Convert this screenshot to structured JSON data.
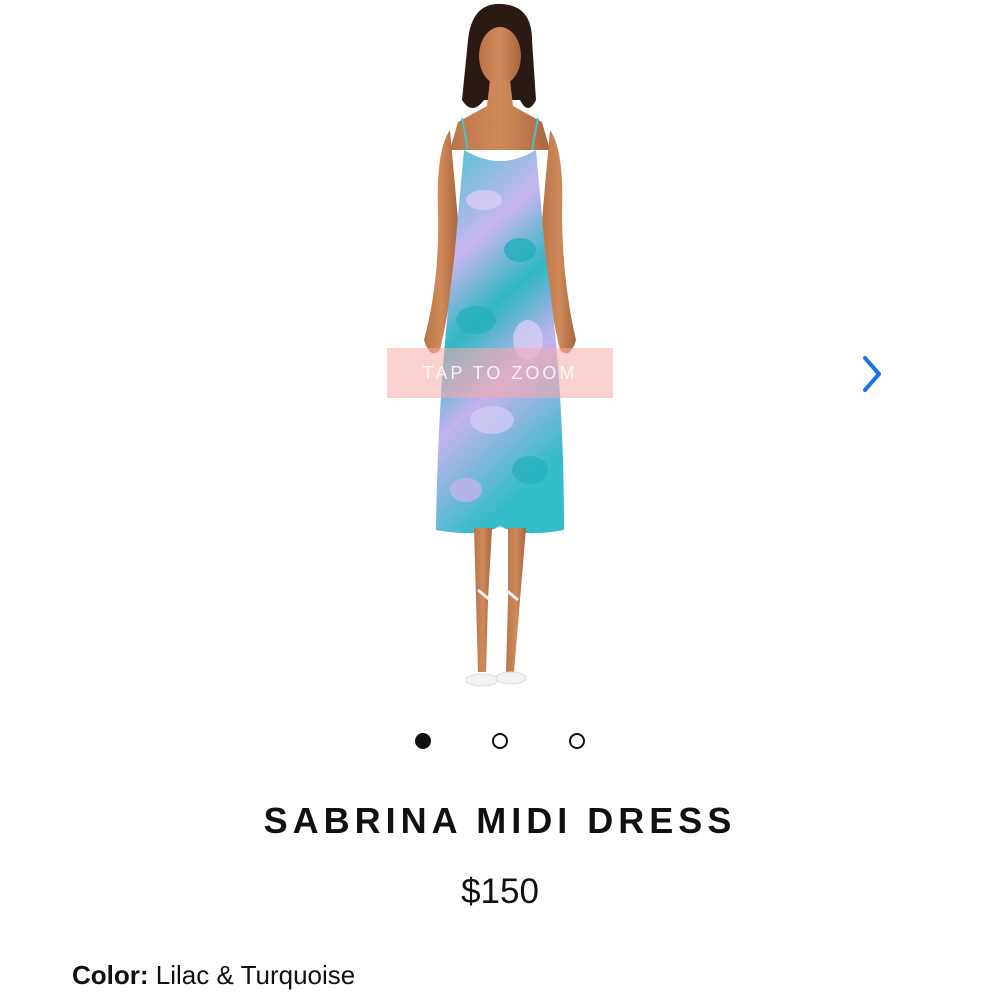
{
  "gallery": {
    "zoom_hint": "TAP TO ZOOM",
    "next_icon": "chevron-right-icon",
    "accent_color": "#1a73e8",
    "slide_count": 3,
    "active_slide": 1
  },
  "product": {
    "name": "SABRINA MIDI DRESS",
    "price": "$150",
    "color_label": "Color:",
    "color_value": "Lilac & Turquoise",
    "dress_colors": [
      "#3fc4cf",
      "#c9b6ef"
    ]
  }
}
